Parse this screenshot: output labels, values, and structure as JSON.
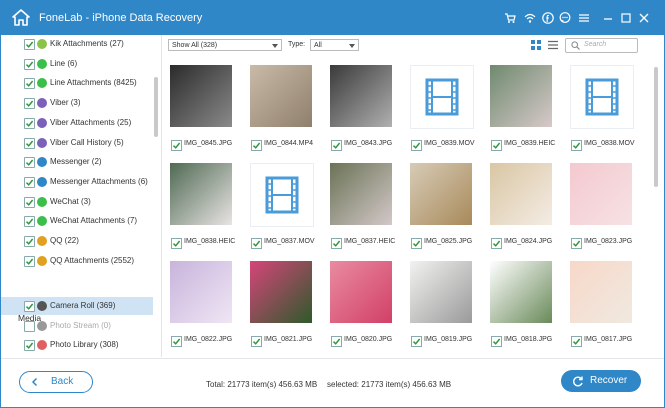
{
  "app": {
    "title": "FoneLab - iPhone Data Recovery"
  },
  "sidebar": {
    "items": [
      {
        "label": "Kik Attachments (27)",
        "icon": "kik-icon",
        "color": "#8bc34a"
      },
      {
        "label": "Line (6)",
        "icon": "line-icon",
        "color": "#3cbf4a"
      },
      {
        "label": "Line Attachments (8425)",
        "icon": "line-icon",
        "color": "#3cbf4a"
      },
      {
        "label": "Viber (3)",
        "icon": "viber-icon",
        "color": "#7b62b8"
      },
      {
        "label": "Viber Attachments (25)",
        "icon": "viber-icon",
        "color": "#7b62b8"
      },
      {
        "label": "Viber Call History (5)",
        "icon": "viber-icon",
        "color": "#7b62b8"
      },
      {
        "label": "Messenger (2)",
        "icon": "messenger-icon",
        "color": "#2f87c8"
      },
      {
        "label": "Messenger Attachments (6)",
        "icon": "messenger-icon",
        "color": "#2f87c8"
      },
      {
        "label": "WeChat (3)",
        "icon": "wechat-icon",
        "color": "#3cbf4a"
      },
      {
        "label": "WeChat Attachments (7)",
        "icon": "wechat-icon",
        "color": "#3cbf4a"
      },
      {
        "label": "QQ (22)",
        "icon": "qq-icon",
        "color": "#e0a020"
      },
      {
        "label": "QQ Attachments (2552)",
        "icon": "qq-icon",
        "color": "#e0a020"
      }
    ],
    "media_heading": "Media",
    "media_items": [
      {
        "label": "Camera Roll (369)",
        "icon": "camera-icon",
        "color": "#555555"
      },
      {
        "label": "Photo Stream (0)",
        "icon": "photo-stream-icon",
        "color": "#999999"
      },
      {
        "label": "Photo Library (308)",
        "icon": "photo-library-icon",
        "color": "#e06060"
      }
    ]
  },
  "toolbar": {
    "show_filter": "Show All (328)",
    "type_label": "Type:",
    "type_value": "All",
    "search_placeholder": "Search"
  },
  "grid": [
    {
      "name": "IMG_0845.JPG",
      "kind": "photo",
      "c1": "#2b2b2b",
      "c2": "#8a8a8a"
    },
    {
      "name": "IMG_0844.MP4",
      "kind": "photo",
      "c1": "#c9bba8",
      "c2": "#8f7f6c"
    },
    {
      "name": "IMG_0843.JPG",
      "kind": "photo",
      "c1": "#3a3a3a",
      "c2": "#b0b0b0"
    },
    {
      "name": "IMG_0839.MOV",
      "kind": "video"
    },
    {
      "name": "IMG_0839.HEIC",
      "kind": "photo",
      "c1": "#6f8a6e",
      "c2": "#d7c9c9"
    },
    {
      "name": "IMG_0838.MOV",
      "kind": "video"
    },
    {
      "name": "IMG_0838.HEIC",
      "kind": "photo",
      "c1": "#4f6a52",
      "c2": "#e9e4e4"
    },
    {
      "name": "IMG_0837.MOV",
      "kind": "video"
    },
    {
      "name": "IMG_0837.HEIC",
      "kind": "photo",
      "c1": "#6a7356",
      "c2": "#d3c8c8"
    },
    {
      "name": "IMG_0825.JPG",
      "kind": "photo",
      "c1": "#d7cbb6",
      "c2": "#a88a5a"
    },
    {
      "name": "IMG_0824.JPG",
      "kind": "photo",
      "c1": "#d9c6a4",
      "c2": "#f4ece4"
    },
    {
      "name": "IMG_0823.JPG",
      "kind": "photo",
      "c1": "#f3c9cf",
      "c2": "#f7e2e4"
    },
    {
      "name": "IMG_0822.JPG",
      "kind": "photo",
      "c1": "#c8b4dc",
      "c2": "#efe6f4"
    },
    {
      "name": "IMG_0821.JPG",
      "kind": "photo",
      "c1": "#d6457a",
      "c2": "#2e5a2a"
    },
    {
      "name": "IMG_0820.JPG",
      "kind": "photo",
      "c1": "#e98ba0",
      "c2": "#d24068"
    },
    {
      "name": "IMG_0819.JPG",
      "kind": "photo",
      "c1": "#f2f2f0",
      "c2": "#9a9a9a"
    },
    {
      "name": "IMG_0818.JPG",
      "kind": "photo",
      "c1": "#ffffff",
      "c2": "#6a8a5a"
    },
    {
      "name": "IMG_0817.JPG",
      "kind": "photo",
      "c1": "#f7d8c8",
      "c2": "#f0e9e0"
    }
  ],
  "footer": {
    "back_label": "Back",
    "total": "Total: 21773 item(s) 456.63 MB",
    "selected": "selected: 21773 item(s) 456.63 MB",
    "recover_label": "Recover"
  },
  "colors": {
    "accent": "#2f87c8",
    "check": "#2b9a3a"
  }
}
